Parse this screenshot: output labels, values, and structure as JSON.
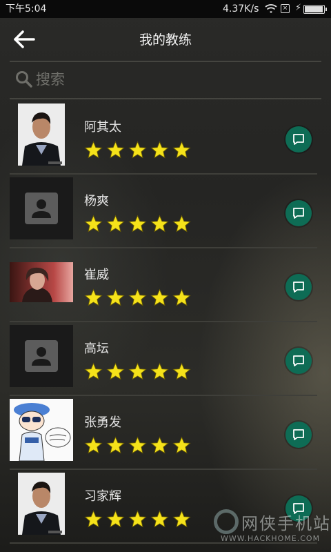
{
  "status_bar": {
    "time": "下午5:04",
    "net_speed": "4.37K/s",
    "sim_label": "×",
    "charge_symbol": "⚡"
  },
  "header": {
    "title": "我的教练"
  },
  "search": {
    "placeholder": "搜索"
  },
  "coaches": [
    {
      "name": "阿其太",
      "rating": 5,
      "avatar": "photo-man"
    },
    {
      "name": "杨爽",
      "rating": 5,
      "avatar": "default-person"
    },
    {
      "name": "崔威",
      "rating": 5,
      "avatar": "photo-man-red"
    },
    {
      "name": "高坛",
      "rating": 5,
      "avatar": "default-person"
    },
    {
      "name": "张勇发",
      "rating": 5,
      "avatar": "cartoon"
    },
    {
      "name": "习家辉",
      "rating": 5,
      "avatar": "photo-man"
    }
  ],
  "watermark": {
    "text": "网侠手机站",
    "url": "WWW.HACKHOME.COM"
  },
  "colors": {
    "chat_button": "#0e6c55",
    "star": "#f5e21a",
    "background": "#252523"
  }
}
